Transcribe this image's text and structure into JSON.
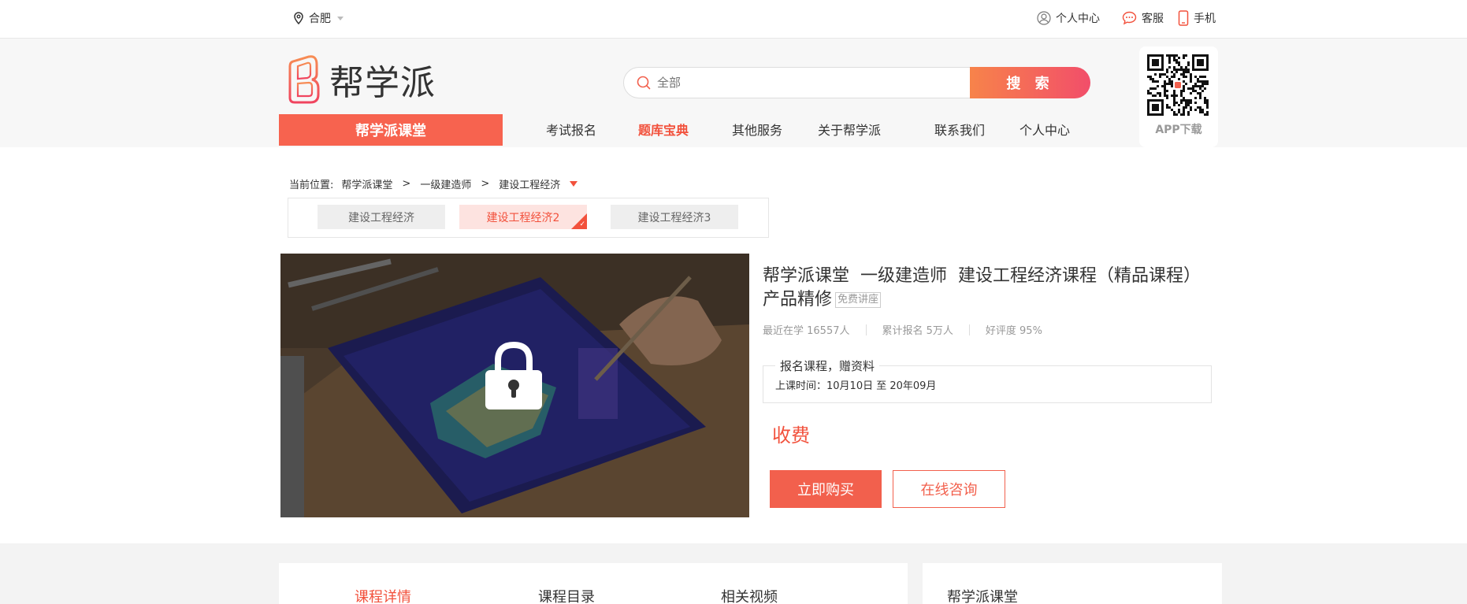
{
  "topbar": {
    "city": "合肥",
    "links": [
      "个人中心",
      "客服",
      "手机"
    ]
  },
  "header": {
    "logo_text": "帮学派",
    "search_placeholder": "全部",
    "search_button": "搜 索",
    "app_download": "APP下载"
  },
  "nav": {
    "brand": "帮学派课堂",
    "items": [
      "考试报名",
      "题库宝典",
      "其他服务",
      "关于帮学派",
      "联系我们",
      "个人中心"
    ],
    "active_index": 1
  },
  "breadcrumb": {
    "label": "当前位置:",
    "crumbs": [
      "帮学派课堂",
      "一级建造师",
      "建设工程经济"
    ],
    "separator": ">"
  },
  "courses": {
    "items": [
      "建设工程经济",
      "建设工程经济2",
      "建设工程经济3"
    ],
    "active_index": 1
  },
  "course": {
    "title_parts": [
      "帮学派课堂",
      "一级建造师",
      "建设工程经济课程（精品课程）产品精修"
    ],
    "free_tag": "免费讲座",
    "stats": [
      "最近在学 16557人",
      "累计报名 5万人",
      "好评度 95%"
    ],
    "promo_title": "报名课程，赠资料",
    "promo_time": "上课时间：10月10日 至 20年09月",
    "price": "收费",
    "buy_button": "立即购买",
    "consult_button": "在线咨询"
  },
  "tabs": {
    "items": [
      "课程详情",
      "课程目录",
      "相关视频"
    ],
    "active_index": 0
  },
  "side": {
    "title": "帮学派课堂"
  },
  "colors": {
    "accent": "#f2513c",
    "brand_button": "#f7634f",
    "search_gradient_start": "#f7834a",
    "search_gradient_end": "#f24e6a"
  },
  "icons": {
    "location": "location-pin-icon",
    "user": "user-icon",
    "service": "chat-bubble-icon",
    "mobile": "mobile-phone-icon",
    "search": "search-icon",
    "lock": "lock-icon",
    "qr": "qr-code"
  }
}
